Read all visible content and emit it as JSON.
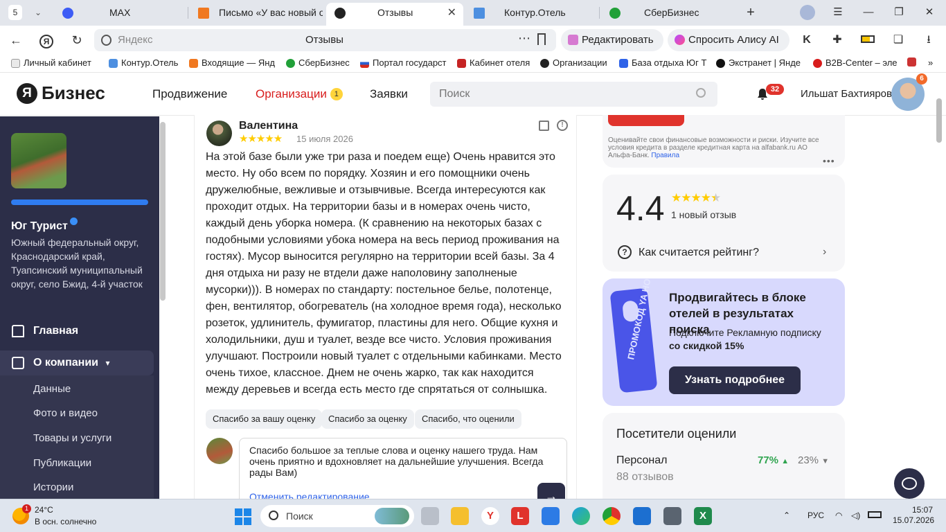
{
  "browser": {
    "tab_count": "5",
    "tabs": [
      {
        "label": "MAX",
        "active": false
      },
      {
        "label": "Письмо «У вас новый отз",
        "active": false
      },
      {
        "label": "Отзывы",
        "active": true
      },
      {
        "label": "Контур.Отель",
        "active": false
      },
      {
        "label": "СберБизнес",
        "active": false
      }
    ],
    "omnibox": {
      "host": "Яндекс",
      "title": "Отзывы"
    },
    "edit_button": "Редактировать",
    "alice_button": "Спросить Алису AI",
    "bookmarks": [
      "Личный кабинет",
      "Контур.Отель",
      "Входящие — Янд",
      "СберБизнес",
      "Портал государст",
      "Кабинет отеля",
      "Организации",
      "База отдыха Юг Т",
      "Экстранет | Янде",
      "B2B-Center – эле"
    ]
  },
  "header": {
    "logo_letter": "Я",
    "logo_text": "Бизнес",
    "nav": [
      {
        "label": "Продвижение"
      },
      {
        "label": "Организации",
        "badge": "1",
        "active": true
      },
      {
        "label": "Заявки"
      }
    ],
    "search_placeholder": "Поиск",
    "notifications_count": "32",
    "user_name": "Ильшат Бахтияров",
    "avatar_badge": "6"
  },
  "sidebar": {
    "org_name": "Юг Турист",
    "org_address": "Южный федеральный округ, Краснодарский край, Туапсинский муниципальный округ, село Бжид, 4-й участок",
    "progress": 1.0,
    "nav": [
      {
        "label": "Главная"
      },
      {
        "label": "О компании"
      }
    ],
    "subitems": [
      "Данные",
      "Фото и видео",
      "Товары и услуги",
      "Публикации",
      "Истории"
    ]
  },
  "review": {
    "author": "Валентина",
    "stars": 5,
    "date": "15 июля 2026",
    "text": "На этой базе были уже три раза и поедем еще) Очень нравится это место. Ну обо всем по порядку. Хозяин и его помощники очень дружелюбные, вежливые и отзывчивые. Всегда интересуются как проходит отдых. На территории базы и в номерах очень чисто, каждый день уборка номера. (К сравнению на некоторых базах с подобными условиями убока номера на весь период проживания на гостях). Мусор выносится регулярно на территории всей базы. За 4 дня отдыха ни разу не втдели даже наполовину заполненые мусорки))). В номерах по стандарту: постельное белье, полотенце, фен, вентилятор, обогреватель (на холодное время года), несколько розеток, удлинитель, фумигатор, пластины для него. Общие кухня и холодильники, душ и туалет, везде все чисто. Условия проживания улучшают. Построили новый туалет с отдельными кабинками. Место очень тихое, классное. Днем не очень жарко, так как находится между деревьев и всегда есть место где спрятаться от солнышка.",
    "quick_replies": [
      "Спасибо за вашу оценку",
      "Спасибо за оценку",
      "Спасибо, что оценили"
    ],
    "reply_text": "Спасибо большое за теплые слова и оценку нашего труда. Нам очень приятно и вдохновляет на дальнейшие улучшения. Всегда рады Вам)",
    "cancel_edit": "Отменить редактирование",
    "send_symbol": "→"
  },
  "ad": {
    "text": "Оценивайте свои финансовые возможности и риски. Изучите все условия кредита в разделе кредитная карта на alfabank.ru АО Альфа-Банк.",
    "link": "Правила"
  },
  "rating": {
    "value": "4.4",
    "stars": 4.4,
    "new_reviews": "1 новый отзыв",
    "how_calculated": "Как считается рейтинг?"
  },
  "promo": {
    "title": "Продвигайтесь в блоке отелей в результатах поиска",
    "subtitle": "Подключите Рекламную подписку",
    "discount": "со скидкой 15%",
    "button": "Узнать подробнее",
    "hanger_text": "ПРОМОКОД YA HOTEL"
  },
  "visitors": {
    "title": "Посетители оценили",
    "label": "Персонал",
    "reviews": "88 отзывов",
    "positive": "77%",
    "negative": "23%"
  },
  "taskbar": {
    "temperature": "24°C",
    "weather": "В осн. солнечно",
    "weather_badge": "1",
    "search_label": "Поиск",
    "lang": "РУС",
    "time": "15:07",
    "date": "15.07.2026"
  },
  "colors": {
    "sidebar_bg": "#2c2e48",
    "accent_red": "#d81c1c",
    "star": "#ffcc00",
    "promo_bg": "#d8d9fd",
    "positive": "#2fa44f"
  }
}
